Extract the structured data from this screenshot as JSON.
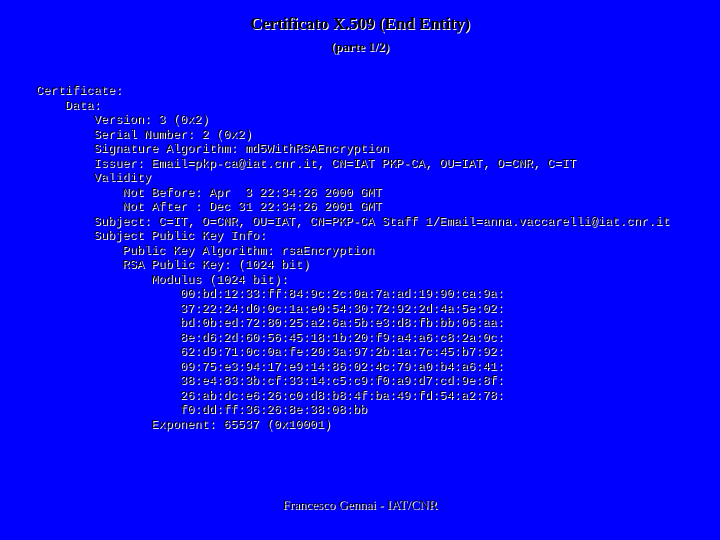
{
  "slide": {
    "title": "Certificato X.509 (End Entity)",
    "subtitle": "(parte 1/2)",
    "background_color": "#0000ff",
    "footer": "Francesco Gennai - IAT/CNR"
  },
  "certificate": {
    "lines": [
      "Certificate:",
      "    Data:",
      "        Version: 3 (0x2)",
      "        Serial Number: 2 (0x2)",
      "        Signature Algorithm: md5WithRSAEncryption",
      "        Issuer: Email=pkp-ca@iat.cnr.it, CN=IAT PKP-CA, OU=IAT, O=CNR, C=IT",
      "        Validity",
      "            Not Before: Apr  3 22:34:26 2000 GMT",
      "            Not After : Dec 31 22:34:26 2001 GMT",
      "        Subject: C=IT, O=CNR, OU=IAT, CN=PKP-CA Staff 1/Email=anna.vaccarelli@iat.cnr.it",
      "        Subject Public Key Info:",
      "            Public Key Algorithm: rsaEncryption",
      "            RSA Public Key: (1024 bit)",
      "                Modulus (1024 bit):",
      "                    00:bd:12:33:ff:84:9c:2c:0a:7a:ad:19:90:ca:9a:",
      "                    37:22:24:d0:0c:1a:e0:54:30:72:92:2d:4a:5e:02:",
      "                    bd:0b:ed:72:80:25:a2:6a:5b:e3:d8:fb:bb:06:aa:",
      "                    8e:d6:2d:60:56:45:18:1b:20:f9:a4:a6:c8:2a:0c:",
      "                    62:d9:71:0c:0a:fe:20:3a:97:2b:1a:7c:45:b7:92:",
      "                    09:75:e3:94:17:e9:14:86:02:4c:79:a0:b4:a6:41:",
      "                    38:e4:83:3b:cf:33:14:c5:c9:f0:a9:d7:cd:9e:8f:",
      "                    26:ab:dc:e6:26:c0:d8:b8:4f:ba:49:fd:54:a2:78:",
      "                    f0:dd:ff:36:26:8e:38:08:bb",
      "                Exponent: 65537 (0x10001)"
    ]
  }
}
